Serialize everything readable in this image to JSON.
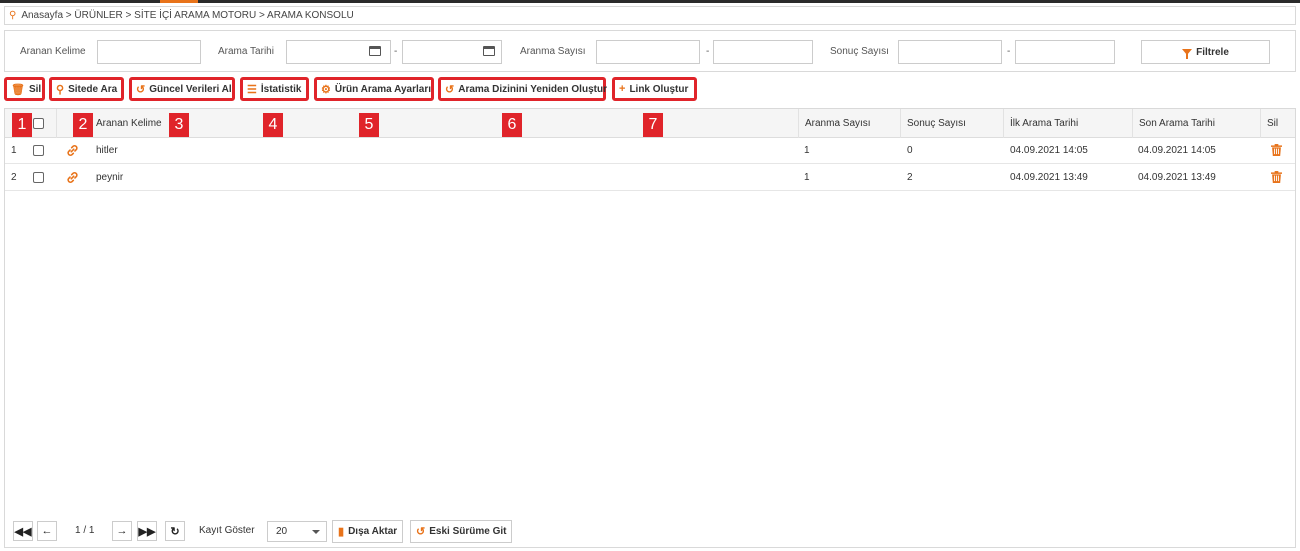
{
  "breadcrumb": "Anasayfa > ÜRÜNLER > SİTE İÇİ ARAMA MOTORU > ARAMA KONSOLU",
  "filters": {
    "aranan_kelime": "Aranan Kelime",
    "arama_tarihi": "Arama Tarihi",
    "aranma_sayisi": "Aranma Sayısı",
    "sonuc_sayisi": "Sonuç Sayısı",
    "range_sep": "-",
    "filter_button": "Filtrele"
  },
  "toolbar": {
    "sil": "Sil",
    "sitede_ara": "Sitede Ara",
    "guncel": "Güncel Verileri Al",
    "istatistik": "İstatistik",
    "urun_arama": "Ürün Arama Ayarları",
    "dizin": "Arama Dizinini Yeniden Oluştur",
    "link": "Link Oluştur"
  },
  "badges": [
    "1",
    "2",
    "3",
    "4",
    "5",
    "6",
    "7"
  ],
  "table": {
    "headers": {
      "keyword": "Aranan Kelime",
      "search_count": "Aranma Sayısı",
      "result_count": "Sonuç Sayısı",
      "first_date": "İlk Arama Tarihi",
      "last_date": "Son Arama Tarihi",
      "delete": "Sil"
    },
    "rows": [
      {
        "num": "1",
        "keyword": "hitler",
        "search_count": "1",
        "result_count": "0",
        "first_date": "04.09.2021 14:05",
        "last_date": "04.09.2021 14:05"
      },
      {
        "num": "2",
        "keyword": "peynir",
        "search_count": "1",
        "result_count": "2",
        "first_date": "04.09.2021 13:49",
        "last_date": "04.09.2021 13:49"
      }
    ]
  },
  "pager": {
    "page_info": "1 / 1",
    "show_label": "Kayıt Göster",
    "page_size": "20",
    "export": "Dışa Aktar",
    "old_version": "Eski Sürüme Git"
  },
  "colors": {
    "accent": "#e8731a",
    "highlight": "#e0242a"
  }
}
